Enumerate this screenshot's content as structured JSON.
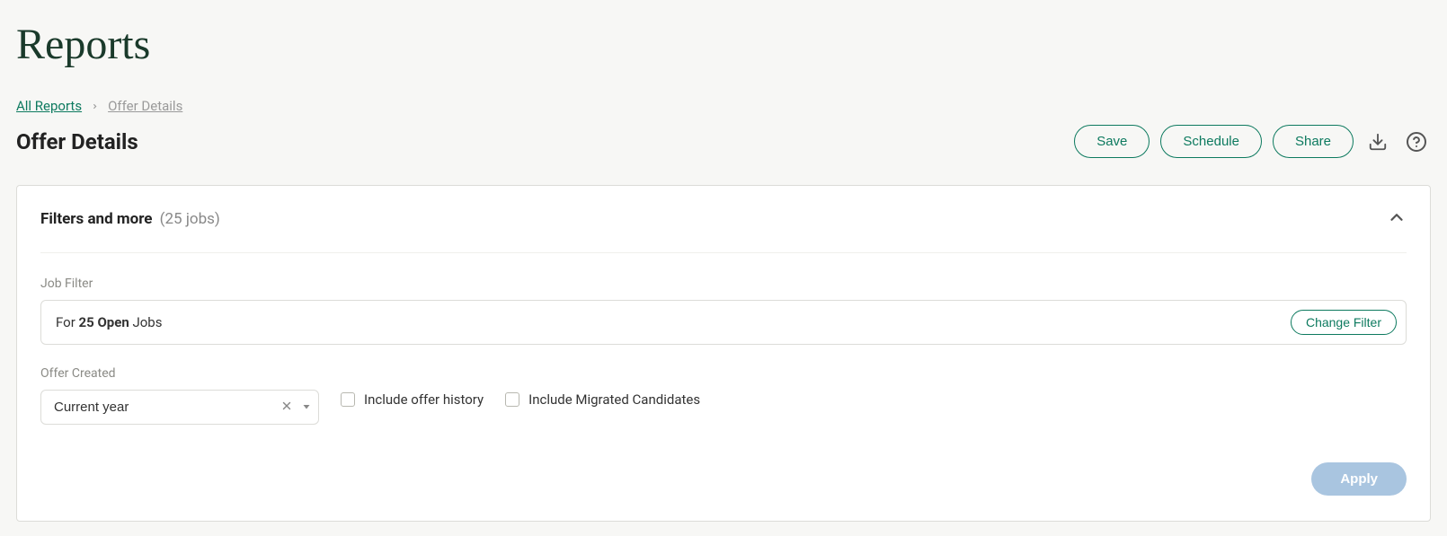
{
  "page": {
    "title": "Reports"
  },
  "breadcrumb": {
    "root": "All Reports",
    "current": "Offer Details"
  },
  "report": {
    "title": "Offer Details"
  },
  "actions": {
    "save": "Save",
    "schedule": "Schedule",
    "share": "Share"
  },
  "filters": {
    "header": "Filters and more",
    "job_count_label": "(25 jobs)",
    "job_filter": {
      "label": "Job Filter",
      "prefix": "For ",
      "bold": "25 Open",
      "suffix": " Jobs",
      "change_btn": "Change Filter"
    },
    "offer_created": {
      "label": "Offer Created",
      "value": "Current year"
    },
    "include_history": "Include offer history",
    "include_migrated": "Include Migrated Candidates",
    "apply": "Apply"
  }
}
